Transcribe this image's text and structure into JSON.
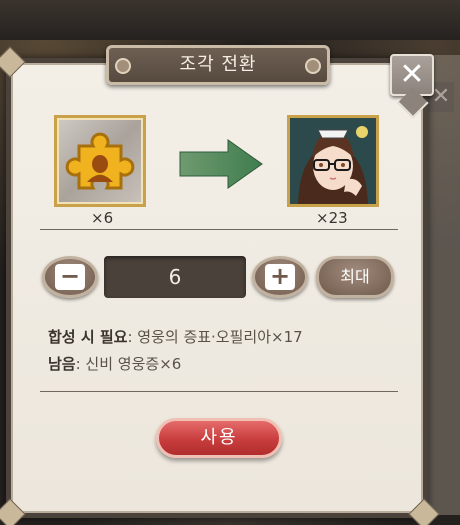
{
  "dialog": {
    "title": "조각 전환",
    "close_icon": "close-icon"
  },
  "conversion": {
    "source": {
      "icon": "puzzle-piece-icon",
      "count_label": "×6"
    },
    "arrow_icon": "right-arrow-icon",
    "target": {
      "icon": "hero-portrait-icon",
      "count_label": "×23"
    }
  },
  "stepper": {
    "minus_icon": "minus-icon",
    "quantity": "6",
    "plus_icon": "plus-icon",
    "max_label": "최대"
  },
  "info": {
    "required_label": "합성 시 필요",
    "required_value": ": 영웅의 증표·오필리아×17",
    "remaining_label": "남음",
    "remaining_value": ": 신비 영웅증×6"
  },
  "actions": {
    "use_label": "사용"
  },
  "colors": {
    "panel": "#f3efe7",
    "border": "#4a423b",
    "accent_arrow": "#4f8a5f",
    "use_button": "#c93d3d",
    "brown_button": "#6f5a4c"
  }
}
